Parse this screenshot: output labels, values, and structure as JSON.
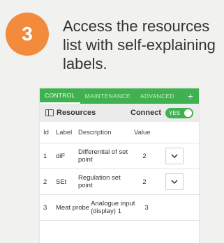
{
  "step": {
    "number": "3",
    "caption": "Access the resources list with self-explaining labels."
  },
  "tabs": {
    "items": [
      {
        "label": "CONTROL",
        "active": true
      },
      {
        "label": "MAINTENANCE",
        "active": false
      },
      {
        "label": "ADVANCED",
        "active": false
      }
    ],
    "add": "+"
  },
  "toolbar": {
    "title": "Resources",
    "connect_label": "Connect",
    "toggle_label": "YES"
  },
  "table": {
    "columns": [
      "Id",
      "Label",
      "Description",
      "Value"
    ],
    "rows": [
      {
        "id": "1",
        "label": "diF",
        "description": "Differential of set point",
        "value": "2"
      },
      {
        "id": "2",
        "label": "SEt",
        "description": "Regulation set point",
        "value": "2"
      },
      {
        "id": "3",
        "label": "Meat probe",
        "description": "Analogue input (display) 1",
        "value": "3"
      }
    ]
  },
  "colors": {
    "accent": "#3fb24f",
    "badge": "#f28c3c"
  }
}
